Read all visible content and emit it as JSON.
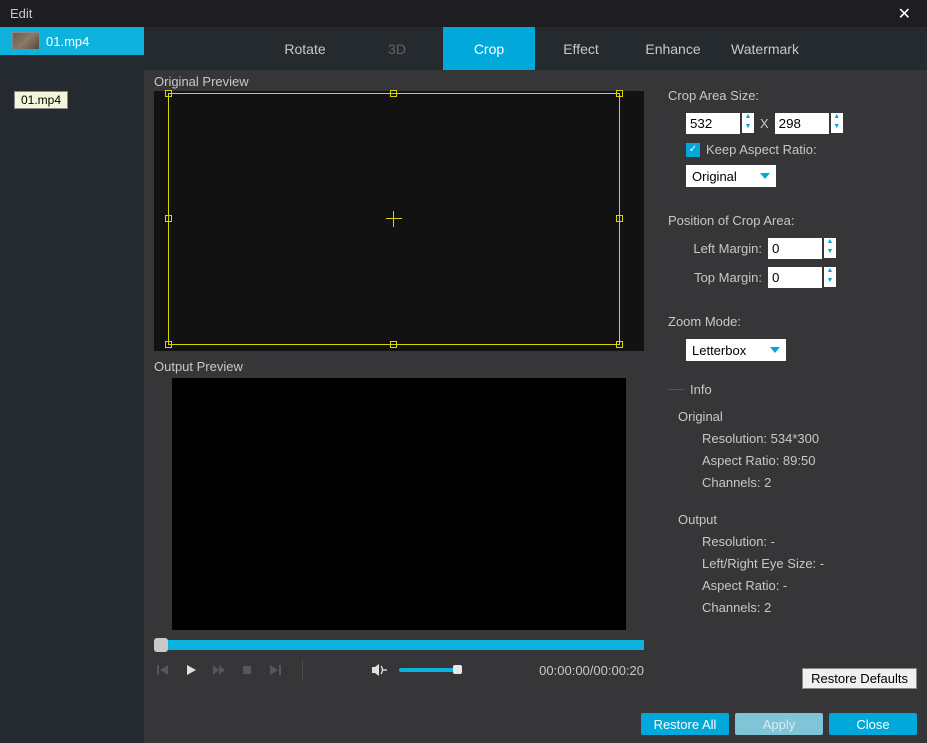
{
  "window": {
    "title": "Edit"
  },
  "sidebar": {
    "items": [
      {
        "label": "01.mp4"
      }
    ],
    "tooltip": "01.mp4"
  },
  "tabs": {
    "rotate": "Rotate",
    "three_d": "3D",
    "crop": "Crop",
    "effect": "Effect",
    "enhance": "Enhance",
    "watermark": "Watermark"
  },
  "preview": {
    "original_label": "Original Preview",
    "output_label": "Output Preview",
    "time": "00:00:00/00:00:20"
  },
  "crop": {
    "section_size": "Crop Area Size:",
    "width": "532",
    "height": "298",
    "x_label": "X",
    "keep_aspect": "Keep Aspect Ratio:",
    "aspect_value": "Original",
    "section_position": "Position of Crop Area:",
    "left_margin_label": "Left Margin:",
    "left_margin": "0",
    "top_margin_label": "Top Margin:",
    "top_margin": "0",
    "zoom_label": "Zoom Mode:",
    "zoom_value": "Letterbox"
  },
  "info": {
    "title": "Info",
    "original_label": "Original",
    "original_resolution": "Resolution: 534*300",
    "original_aspect": "Aspect Ratio: 89:50",
    "original_channels": "Channels: 2",
    "output_label": "Output",
    "output_resolution": "Resolution: -",
    "output_eyesize": "Left/Right Eye Size: -",
    "output_aspect": "Aspect Ratio: -",
    "output_channels": "Channels: 2"
  },
  "buttons": {
    "restore_defaults": "Restore Defaults",
    "restore_all": "Restore All",
    "apply": "Apply",
    "close": "Close"
  }
}
